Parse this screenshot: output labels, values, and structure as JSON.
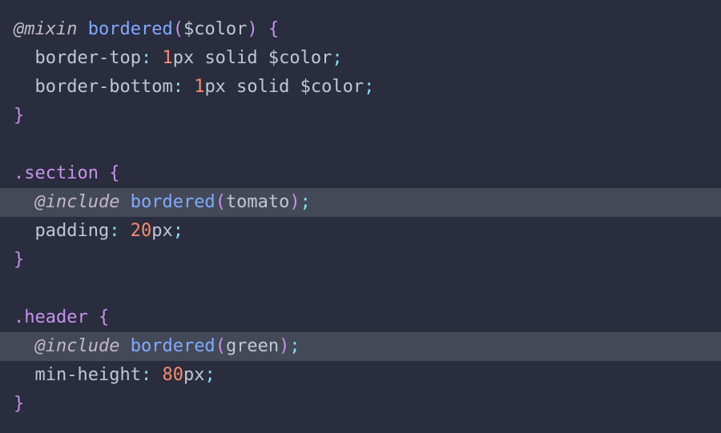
{
  "code_lines": [
    {
      "indent": "",
      "tokens": [
        {
          "t": "@mixin",
          "c": "at"
        },
        {
          "t": " ",
          "c": "text"
        },
        {
          "t": "bordered",
          "c": "func"
        },
        {
          "t": "(",
          "c": "punct"
        },
        {
          "t": "$color",
          "c": "var"
        },
        {
          "t": ")",
          "c": "punct"
        },
        {
          "t": " ",
          "c": "text"
        },
        {
          "t": "{",
          "c": "punct"
        }
      ]
    },
    {
      "indent": "  ",
      "tokens": [
        {
          "t": "border-top",
          "c": "prop"
        },
        {
          "t": ":",
          "c": "colon"
        },
        {
          "t": " ",
          "c": "text"
        },
        {
          "t": "1",
          "c": "num"
        },
        {
          "t": "px solid $color",
          "c": "text"
        },
        {
          "t": ";",
          "c": "semi"
        }
      ]
    },
    {
      "indent": "  ",
      "tokens": [
        {
          "t": "border-bottom",
          "c": "prop"
        },
        {
          "t": ":",
          "c": "colon"
        },
        {
          "t": " ",
          "c": "text"
        },
        {
          "t": "1",
          "c": "num"
        },
        {
          "t": "px solid $color",
          "c": "text"
        },
        {
          "t": ";",
          "c": "semi"
        }
      ]
    },
    {
      "indent": "",
      "tokens": [
        {
          "t": "}",
          "c": "punct"
        }
      ]
    },
    {
      "indent": "",
      "tokens": []
    },
    {
      "indent": "",
      "tokens": [
        {
          "t": ".section",
          "c": "sel"
        },
        {
          "t": " ",
          "c": "text"
        },
        {
          "t": "{",
          "c": "punct"
        }
      ]
    },
    {
      "indent": "  ",
      "highlight": true,
      "tokens": [
        {
          "t": "@include",
          "c": "at"
        },
        {
          "t": " ",
          "c": "text"
        },
        {
          "t": "bordered",
          "c": "func"
        },
        {
          "t": "(",
          "c": "punct"
        },
        {
          "t": "tomato",
          "c": "text"
        },
        {
          "t": ")",
          "c": "punct"
        },
        {
          "t": ";",
          "c": "semi"
        }
      ]
    },
    {
      "indent": "  ",
      "tokens": [
        {
          "t": "padding",
          "c": "prop"
        },
        {
          "t": ":",
          "c": "colon"
        },
        {
          "t": " ",
          "c": "text"
        },
        {
          "t": "20",
          "c": "num"
        },
        {
          "t": "px",
          "c": "text"
        },
        {
          "t": ";",
          "c": "semi"
        }
      ]
    },
    {
      "indent": "",
      "tokens": [
        {
          "t": "}",
          "c": "punct"
        }
      ]
    },
    {
      "indent": "",
      "tokens": []
    },
    {
      "indent": "",
      "tokens": [
        {
          "t": ".header",
          "c": "sel"
        },
        {
          "t": " ",
          "c": "text"
        },
        {
          "t": "{",
          "c": "punct"
        }
      ]
    },
    {
      "indent": "  ",
      "highlight": true,
      "tokens": [
        {
          "t": "@include",
          "c": "at"
        },
        {
          "t": " ",
          "c": "text"
        },
        {
          "t": "bordered",
          "c": "func"
        },
        {
          "t": "(",
          "c": "punct"
        },
        {
          "t": "green",
          "c": "text"
        },
        {
          "t": ")",
          "c": "punct"
        },
        {
          "t": ";",
          "c": "semi"
        }
      ]
    },
    {
      "indent": "  ",
      "tokens": [
        {
          "t": "min-height",
          "c": "prop"
        },
        {
          "t": ":",
          "c": "colon"
        },
        {
          "t": " ",
          "c": "text"
        },
        {
          "t": "80",
          "c": "num"
        },
        {
          "t": "px",
          "c": "text"
        },
        {
          "t": ";",
          "c": "semi"
        }
      ]
    },
    {
      "indent": "",
      "tokens": [
        {
          "t": "}",
          "c": "punct"
        }
      ]
    }
  ],
  "colors": {
    "background": "#292d3e",
    "highlight_line": "#444957",
    "keyword": "#c3b9c5",
    "function": "#82aaff",
    "brace": "#c792ea",
    "number": "#f78c6c",
    "text": "#bfc7d5"
  }
}
